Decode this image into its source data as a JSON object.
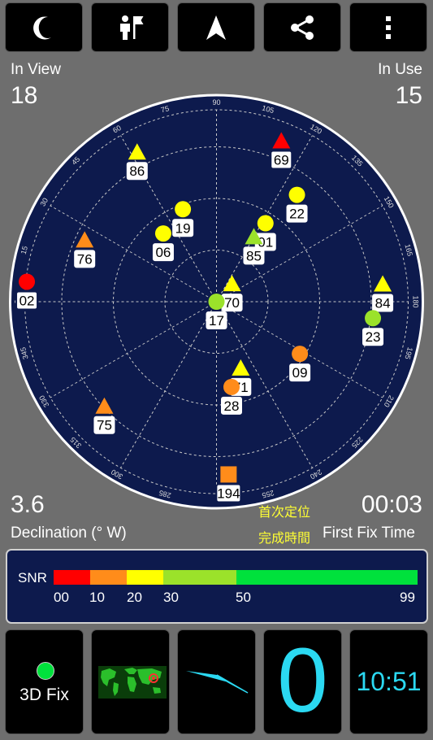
{
  "toolbar": {
    "buttons": [
      {
        "name": "night-mode-button",
        "icon": "moon-icon"
      },
      {
        "name": "location-button",
        "icon": "person-flag-icon"
      },
      {
        "name": "navigate-button",
        "icon": "navigation-arrow-icon"
      },
      {
        "name": "share-button",
        "icon": "share-icon"
      },
      {
        "name": "more-button",
        "icon": "more-vert-icon"
      }
    ]
  },
  "stats": {
    "in_view_label": "In View",
    "in_view": "18",
    "in_use_label": "In Use",
    "in_use": "15",
    "declination_value": "3.6",
    "declination_label": "Declination (° W)",
    "fix_time_value": "00:03",
    "fix_time_cn_1": "首次定位",
    "fix_time_cn_2": "完成時間",
    "fix_time_label": "First Fix Time"
  },
  "sky": {
    "azimuth_ticks": [
      "0",
      "15",
      "30",
      "45",
      "60",
      "75",
      "90",
      "105",
      "120",
      "135",
      "150",
      "165",
      "180",
      "195",
      "210",
      "225",
      "240",
      "255",
      "285",
      "300",
      "315",
      "330",
      "345"
    ],
    "satellites": [
      {
        "id": "84",
        "shape": "triangle",
        "color": "#ffff00",
        "az": 84,
        "el": 85,
        "boxed": false
      },
      {
        "id": "23",
        "shape": "circle",
        "color": "#9be22a",
        "az": 96,
        "el": 80,
        "boxed": false
      },
      {
        "id": "22",
        "shape": "circle",
        "color": "#ffff00",
        "az": 37,
        "el": 68,
        "boxed": false
      },
      {
        "id": "69",
        "shape": "triangle",
        "color": "#ff0000",
        "az": 22,
        "el": 88,
        "boxed": true
      },
      {
        "id": "01",
        "shape": "circle",
        "color": "#ffff00",
        "az": 32,
        "el": 47,
        "boxed": false
      },
      {
        "id": "85",
        "shape": "triangle",
        "color": "#9be22a",
        "az": 30,
        "el": 38,
        "boxed": false
      },
      {
        "id": "70",
        "shape": "triangle",
        "color": "#ffff00",
        "az": 41,
        "el": 12,
        "boxed": false
      },
      {
        "id": "09",
        "shape": "circle",
        "color": "#ff8c1a",
        "az": 122,
        "el": 50,
        "boxed": false
      },
      {
        "id": "17",
        "shape": "circle",
        "color": "#9be22a",
        "az": 12,
        "el": 0,
        "boxed": false
      },
      {
        "id": "71",
        "shape": "triangle",
        "color": "#ffff00",
        "az": 160,
        "el": 36,
        "boxed": false
      },
      {
        "id": "19",
        "shape": "circle",
        "color": "#ffff00",
        "az": 340,
        "el": 50,
        "boxed": false
      },
      {
        "id": "86",
        "shape": "triangle",
        "color": "#ffff00",
        "az": 332,
        "el": 86,
        "boxed": false
      },
      {
        "id": "28",
        "shape": "circle",
        "color": "#ff8c1a",
        "az": 170,
        "el": 44,
        "boxed": false
      },
      {
        "id": "194",
        "shape": "square",
        "color": "#ff8c1a",
        "az": 176,
        "el": 88,
        "boxed": true
      },
      {
        "id": "06",
        "shape": "circle",
        "color": "#ffff00",
        "az": 322,
        "el": 44,
        "boxed": false
      },
      {
        "id": "76",
        "shape": "triangle",
        "color": "#ff8c1a",
        "az": 295,
        "el": 74,
        "boxed": false
      },
      {
        "id": "75",
        "shape": "triangle",
        "color": "#ff8c1a",
        "az": 227,
        "el": 78,
        "boxed": false
      },
      {
        "id": "02",
        "shape": "circle",
        "color": "#ff0000",
        "az": 276,
        "el": 97,
        "boxed": true
      }
    ]
  },
  "snr": {
    "label": "SNR",
    "ticks": [
      "00",
      "10",
      "20",
      "30",
      "50",
      "99"
    ],
    "colors": {
      "red": "#ff0000",
      "orange": "#ff8c1a",
      "yellow": "#ffff00",
      "lime": "#9be22a",
      "green": "#00e13c"
    }
  },
  "bottom": {
    "fix_status": "3D Fix",
    "fix_color": "#00e13c",
    "speed": "0",
    "clock": "10:51",
    "accent": "#2bd9f2"
  }
}
